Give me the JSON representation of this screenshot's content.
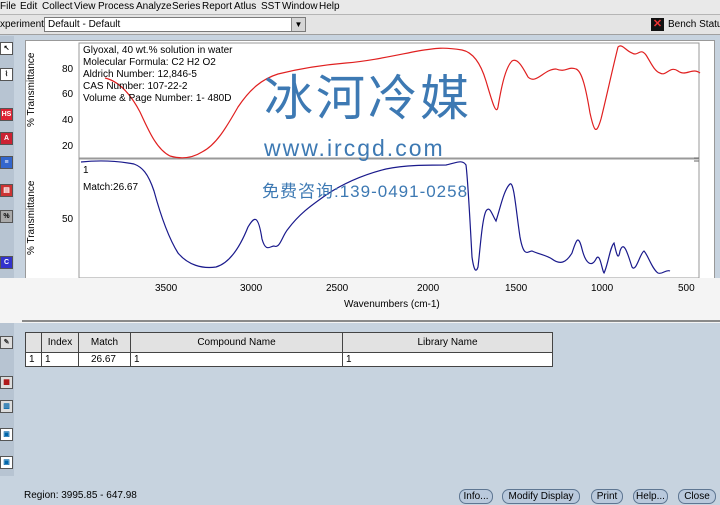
{
  "menu": [
    "File",
    "Edit",
    "Collect",
    "View",
    "Process",
    "Analyze",
    "Series",
    "Report",
    "Atlus",
    "SST",
    "Window",
    "Help"
  ],
  "experiment": {
    "label": "xperiment:",
    "value": "Default - Default"
  },
  "bench": {
    "label": "Bench Status"
  },
  "spectrum_top": {
    "title": "Glyoxal, 40 wt.% solution in water",
    "formula": "Molecular Formula:  C2 H2 O2",
    "aldrich": "Aldrich Number:  12,846-5",
    "cas": "CAS Number:  107-22-2",
    "volume": "Volume & Page Number:  1- 480D",
    "ylabel": "% Transmittance",
    "yticks": [
      "80",
      "60",
      "40",
      "20"
    ],
    "color": "#e02020"
  },
  "spectrum_bottom": {
    "index": "1",
    "match": "Match:26.67",
    "ylabel": "% Transmittance",
    "yticks": [
      "50"
    ],
    "color": "#1a1a8c"
  },
  "xaxis": {
    "label": "Wavenumbers (cm-1)",
    "ticks": [
      "3500",
      "3000",
      "2500",
      "2000",
      "1500",
      "1000",
      "500"
    ]
  },
  "watermark": {
    "title": "冰河冷媒",
    "url": "www.ircgd.com",
    "phone": "免费咨询:139-0491-0258"
  },
  "results_table": {
    "headers": [
      "Index",
      "Match",
      "Compound Name",
      "Library Name"
    ],
    "rows": [
      [
        "1",
        "1",
        "26.67",
        "1",
        "1"
      ]
    ]
  },
  "status": {
    "region": "Region:  3995.85 - 647.98"
  },
  "buttons": [
    "Info...",
    "Modify Display",
    "Print",
    "Help...",
    "Close"
  ]
}
